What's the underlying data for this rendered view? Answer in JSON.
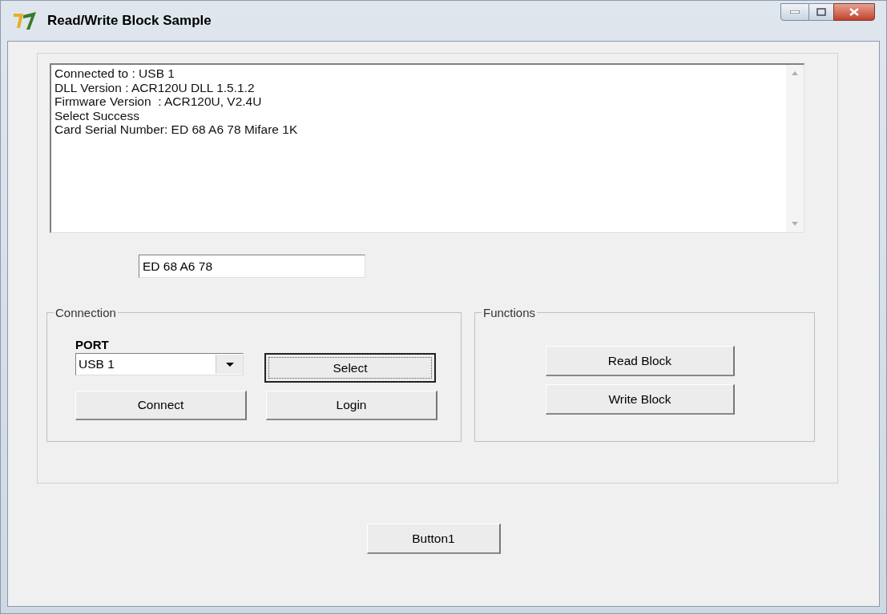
{
  "window": {
    "title": "Read/Write Block Sample"
  },
  "log": {
    "lines": [
      "Connected to : USB 1",
      "DLL Version : ACR120U DLL 1.5.1.2",
      "Firmware Version  : ACR120U, V2.4U",
      "Select Success",
      "Card Serial Number: ED 68 A6 78 Mifare 1K"
    ]
  },
  "serial_field": {
    "value": "ED 68 A6 78"
  },
  "connection": {
    "title": "Connection",
    "port_label": "PORT",
    "port_value": "USB 1",
    "buttons": [
      {
        "label": "Select",
        "focused": true
      },
      {
        "label": "Connect",
        "focused": false
      },
      {
        "label": "Login",
        "focused": false
      }
    ]
  },
  "functions": {
    "title": "Functions",
    "buttons": [
      {
        "label": "Read Block",
        "focused": false
      },
      {
        "label": "Write Block",
        "focused": false
      }
    ]
  },
  "bottom_button": {
    "label": "Button1",
    "focused": false
  }
}
